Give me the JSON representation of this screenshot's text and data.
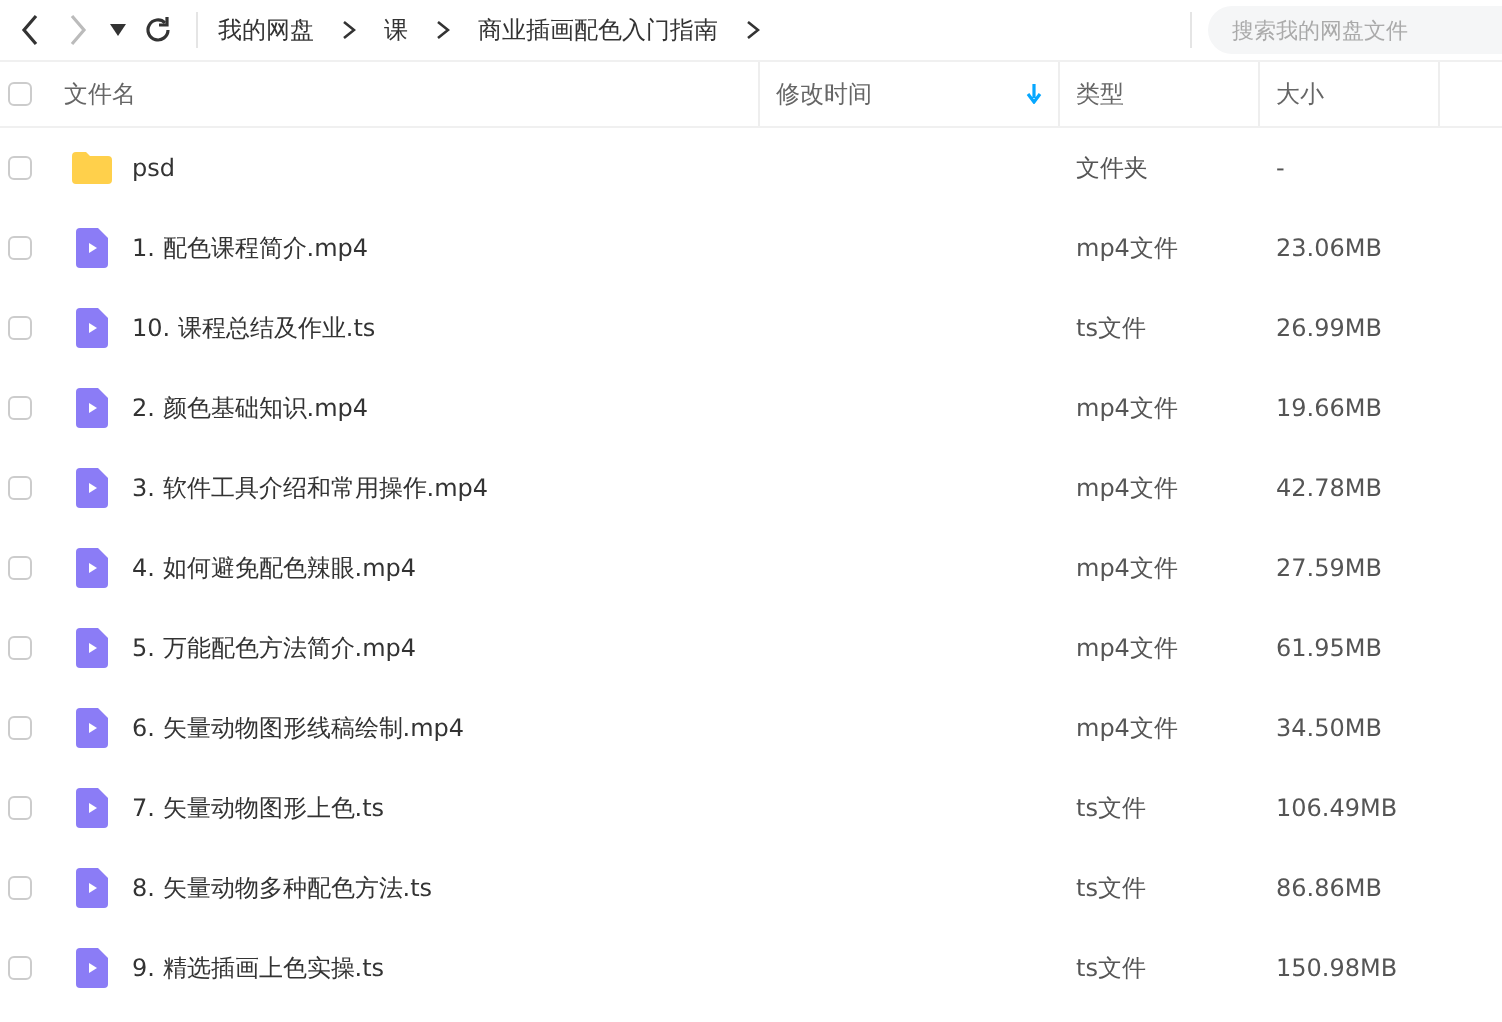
{
  "toolbar": {
    "breadcrumbs": [
      "我的网盘",
      "课",
      "商业插画配色入门指南"
    ],
    "search": {
      "placeholder": "搜索我的网盘文件"
    }
  },
  "table": {
    "columns": [
      {
        "label": "文件名",
        "sorted": false
      },
      {
        "label": "修改时间",
        "sorted": true
      },
      {
        "label": "类型",
        "sorted": false
      },
      {
        "label": "大小",
        "sorted": false
      }
    ],
    "header_checked": false,
    "rows": [
      {
        "kind": "folder",
        "name": "psd",
        "modified": "",
        "type": "文件夹",
        "size": "-",
        "checked": false
      },
      {
        "kind": "video",
        "name": "1. 配色课程简介.mp4",
        "type": "mp4文件",
        "size": "23.06MB",
        "checked": false
      },
      {
        "kind": "video",
        "name": "10. 课程总结及作业.ts",
        "type": "ts文件",
        "size": "26.99MB",
        "checked": false
      },
      {
        "kind": "video",
        "name": "2. 颜色基础知识.mp4",
        "type": "mp4文件",
        "size": "19.66MB",
        "checked": false
      },
      {
        "kind": "video",
        "name": "3. 软件工具介绍和常用操作.mp4",
        "type": "mp4文件",
        "size": "42.78MB",
        "checked": false
      },
      {
        "kind": "video",
        "name": "4. 如何避免配色辣眼.mp4",
        "type": "mp4文件",
        "size": "27.59MB",
        "checked": false
      },
      {
        "kind": "video",
        "name": "5. 万能配色方法简介.mp4",
        "type": "mp4文件",
        "size": "61.95MB",
        "checked": false
      },
      {
        "kind": "video",
        "name": "6. 矢量动物图形线稿绘制.mp4",
        "type": "mp4文件",
        "size": "34.50MB",
        "checked": false
      },
      {
        "kind": "video",
        "name": "7. 矢量动物图形上色.ts",
        "type": "ts文件",
        "size": "106.49MB",
        "checked": false
      },
      {
        "kind": "video",
        "name": "8. 矢量动物多种配色方法.ts",
        "type": "ts文件",
        "size": "86.86MB",
        "checked": false
      },
      {
        "kind": "video",
        "name": "9. 精选插画上色实操.ts",
        "type": "ts文件",
        "size": "150.98MB",
        "checked": false
      }
    ]
  }
}
